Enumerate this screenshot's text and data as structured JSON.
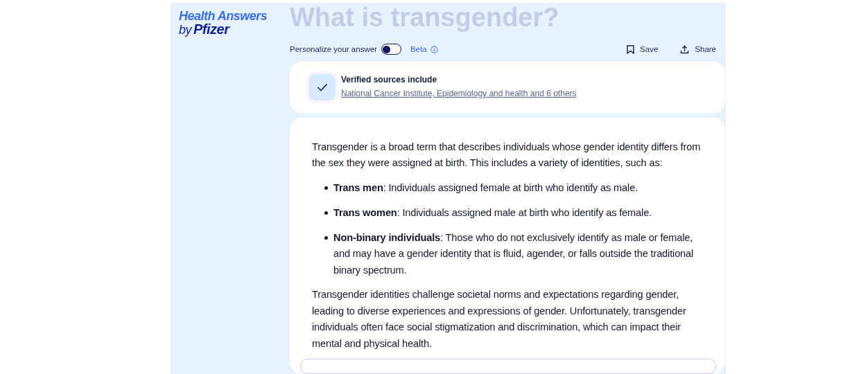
{
  "logo": {
    "line_1": "Health Answers",
    "line_2_prefix": "by",
    "line_2_brand": "Pfizer"
  },
  "title": "What is transgender?",
  "toolbar": {
    "personalize": {
      "label": "Personalize your answer",
      "on": false
    },
    "badge": "Beta",
    "actions": [
      {
        "kind": "save",
        "label": "Save"
      },
      {
        "kind": "share",
        "label": "Share"
      }
    ]
  },
  "sources": {
    "heading": "Verified sources include",
    "link": "National Cancer Institute, Epidemiology and health and 6 others"
  },
  "answer": {
    "intro": "Transgender is a broad term that describes individuals whose gender identity differs from the sex they were assigned at birth. This includes a variety of identities, such as:",
    "bullets": [
      {
        "term": "Trans men",
        "text": ": Individuals assigned female at birth who identify as male."
      },
      {
        "term": "Trans women",
        "text": ": Individuals assigned male at birth who identify as female."
      },
      {
        "term": "Non-binary individuals",
        "text": ": Those who do not exclusively identify as male or female, and may have a gender identity that is fluid, agender, or falls outside the traditional binary spectrum."
      }
    ],
    "closing": "Transgender identities challenge societal norms and expectations regarding gender, leading to diverse experiences and expressions of gender. Unfortunately, transgender individuals often face social stigmatization and discrimination, which can impact their mental and physical health."
  }
}
